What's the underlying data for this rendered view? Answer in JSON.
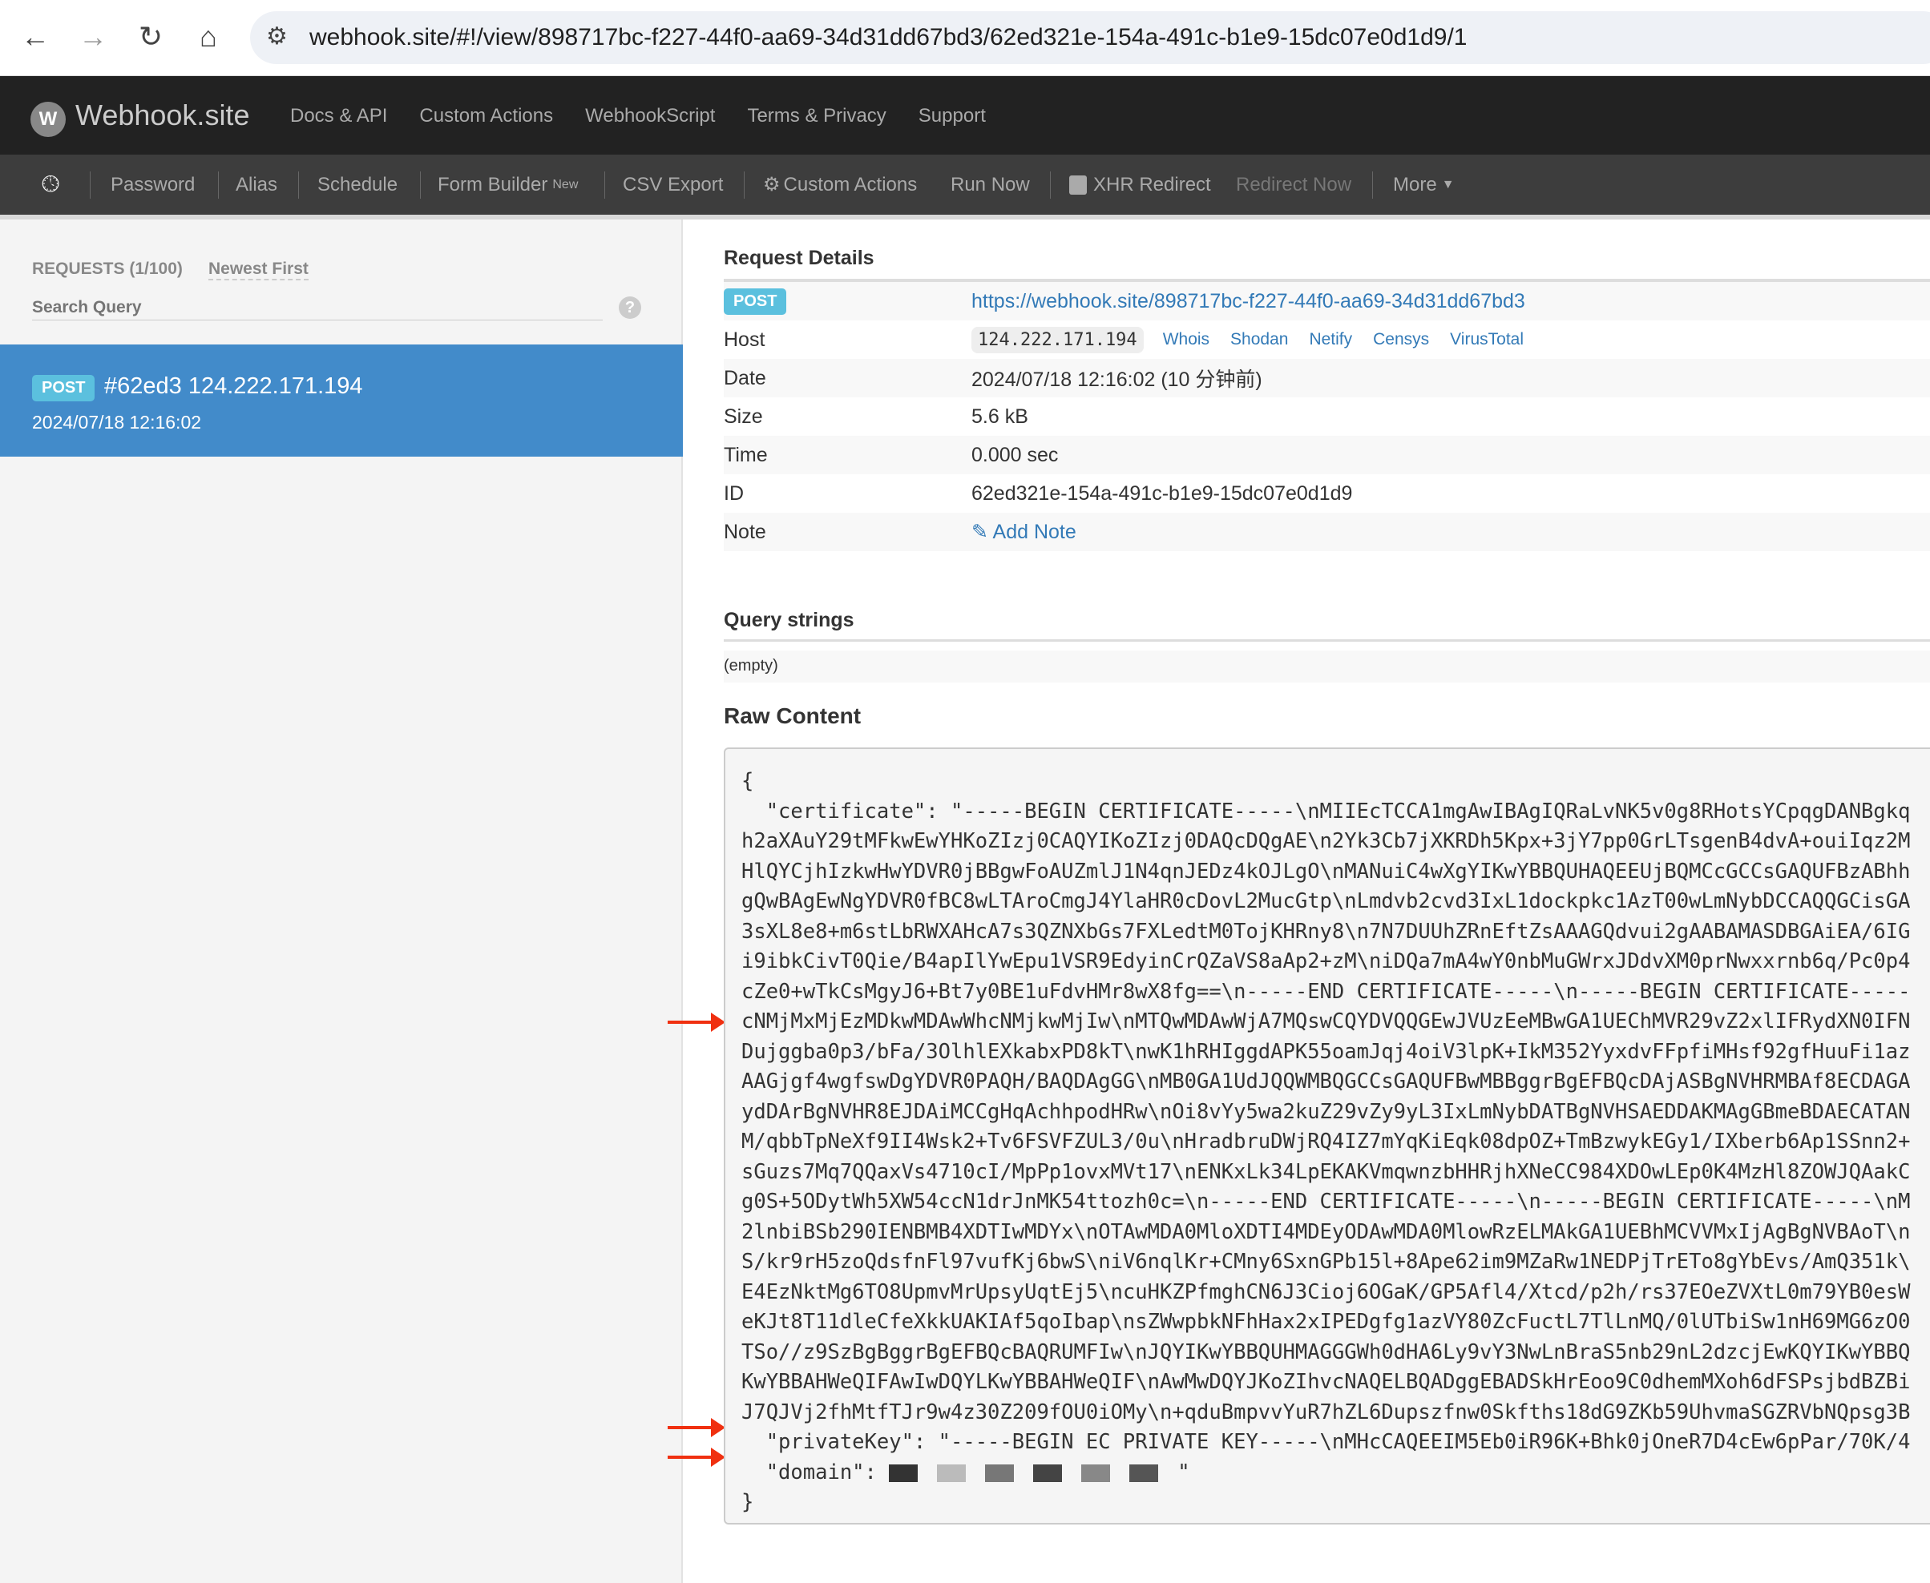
{
  "browser": {
    "url": "webhook.site/#!/view/898717bc-f227-44f0-aa69-34d31dd67bd3/62ed321e-154a-491c-b1e9-15dc07e0d1d9/1"
  },
  "nav": {
    "brand": "Webhook.site",
    "links": [
      "Docs & API",
      "Custom Actions",
      "WebhookScript",
      "Terms & Privacy",
      "Support"
    ]
  },
  "toolbar": {
    "password": "Password",
    "alias": "Alias",
    "schedule": "Schedule",
    "form_builder": "Form Builder",
    "form_builder_badge": "New",
    "csv_export": "CSV Export",
    "custom_actions": "Custom Actions",
    "run_now": "Run Now",
    "xhr_redirect": "XHR Redirect",
    "redirect_now": "Redirect Now",
    "more": "More"
  },
  "sidebar": {
    "requests_label": "REQUESTS (1/100)",
    "sort_label": "Newest First",
    "search_placeholder": "Search Query",
    "help": "?",
    "items": [
      {
        "method": "POST",
        "title": "#62ed3 124.222.171.194",
        "date": "2024/07/18 12:16:02"
      }
    ]
  },
  "details": {
    "heading": "Request Details",
    "method": "POST",
    "url": "https://webhook.site/898717bc-f227-44f0-aa69-34d31dd67bd3",
    "host_label": "Host",
    "host": "124.222.171.194",
    "host_links": [
      "Whois",
      "Shodan",
      "Netify",
      "Censys",
      "VirusTotal"
    ],
    "date_label": "Date",
    "date": "2024/07/18 12:16:02 (10 分钟前)",
    "size_label": "Size",
    "size": "5.6 kB",
    "time_label": "Time",
    "time": "0.000 sec",
    "id_label": "ID",
    "id": "62ed321e-154a-491c-b1e9-15dc07e0d1d9",
    "note_label": "Note",
    "add_note": "Add Note"
  },
  "query": {
    "heading": "Query strings",
    "value": "(empty)"
  },
  "raw": {
    "heading": "Raw Content",
    "lines": [
      "{",
      "  \"certificate\": \"-----BEGIN CERTIFICATE-----\\nMIIEcTCCA1mgAwIBAgIQRaLvNK5v0g8RHotsYCpqgDANBgkq",
      "h2aXAuY29tMFkwEwYHKoZIzj0CAQYIKoZIzj0DAQcDQgAE\\n2Yk3Cb7jXKRDh5Kpx+3jY7pp0GrLTsgenB4dvA+ouiIqz2M",
      "HlQYCjhIzkwHwYDVR0jBBgwFoAUZmlJ1N4qnJEDz4kOJLgO\\nMANuiC4wXgYIKwYBBQUHAQEEUjBQMCcGCCsGAQUFBzABhh",
      "gQwBAgEwNgYDVR0fBC8wLTAroCmgJ4YlaHR0cDovL2MucGtp\\nLmdvb2cvd3IxL1dockpkc1AzT00wLmNybDCCAQQGCisGA",
      "3sXL8e8+m6stLbRWXAHcA7s3QZNXbGs7FXLedtM0TojKHRny8\\n7N7DUUhZRnEftZsAAAGQdvui2gAABAMASDBGAiEA/6IG",
      "i9ibkCivT0Qie/B4apIlYwEpu1VSR9EdyinCrQZaVS8aAp2+zM\\niDQa7mA4wY0nbMuGWrxJDdvXM0prNwxxrnb6q/Pc0p4",
      "cZe0+wTkCsMgyJ6+Bt7y0BE1uFdvHMr8wX8fg==\\n-----END CERTIFICATE-----\\n-----BEGIN CERTIFICATE-----",
      "cNMjMxMjEzMDkwMDAwWhcNMjkwMjIw\\nMTQwMDAwWjA7MQswCQYDVQQGEwJVUzEeMBwGA1UEChMVR29vZ2xlIFRydXN0IFN",
      "Dujggba0p3/bFa/3OlhlEXkabxPD8kT\\nwK1hRHIggdAPK55oamJqj4oiV3lpK+IkM352YyxdvFFpfiMHsf92gfHuuFi1az",
      "AAGjgf4wgfswDgYDVR0PAQH/BAQDAgGG\\nMB0GA1UdJQQWMBQGCCsGAQUFBwMBBggrBgEFBQcDAjASBgNVHRMBAf8ECDAGA",
      "ydDArBgNVHR8EJDAiMCCgHqAchhpodHRw\\nOi8vYy5wa2kuZ29vZy9yL3IxLmNybDATBgNVHSAEDDAKMAgGBmeBDAECATAN",
      "M/qbbTpNeXf9II4Wsk2+Tv6FSVFZUL3/0u\\nHradbruDWjRQ4IZ7mYqKiEqk08dpOZ+TmBzwykEGy1/IXberb6Ap1SSnn2+",
      "sGuzs7Mq7QQaxVs4710cI/MpPp1ovxMVt17\\nENKxLk34LpEKAKVmqwnzbHHRjhXNeCC984XDOwLEp0K4MzHl8ZOWJQAakC",
      "g0S+5ODytWh5XW54ccN1drJnMK54ttozh0c=\\n-----END CERTIFICATE-----\\n-----BEGIN CERTIFICATE-----\\nM",
      "2lnbiBSb290IENBMB4XDTIwMDYx\\nOTAwMDA0MloXDTI4MDEyODAwMDA0MlowRzELMAkGA1UEBhMCVVMxIjAgBgNVBAoT\\n",
      "S/kr9rH5zoQdsfnFl97vufKj6bwS\\niV6nqlKr+CMny6SxnGPb15l+8Ape62im9MZaRw1NEDPjTrETo8gYbEvs/AmQ351k\\",
      "E4EzNktMg6TO8UpmvMrUpsyUqtEj5\\ncuHKZPfmghCN6J3Cioj6OGaK/GP5Afl4/Xtcd/p2h/rs37EOeZVXtL0m79YB0esW",
      "eKJt8T11dleCfeXkkUAKIAf5qoIbap\\nsZWwpbkNFhHax2xIPEDgfg1azVY80ZcFuctL7TlLnMQ/0lUTbiSw1nH69MG6zO0",
      "TSo//z9SzBgBggrBgEFBQcBAQRUMFIw\\nJQYIKwYBBQUHMAGGGWh0dHA6Ly9vY3NwLnBraS5nb29nL2dzcjEwKQYIKwYBBQ",
      "KwYBBAHWeQIFAwIwDQYLKwYBBAHWeQIF\\nAwMwDQYJKoZIhvcNAQELBQADggEBADSkHrEoo9C0dhemMXoh6dFSPsjbdBZBi",
      "J7QJVj2fhMtfTJr9w4z30Z209fOU0iOMy\\n+qduBmpvvYuR7hZL6Dupszfnw0Skfths18dG9ZKb59UhvmaSGZRVbNQpsg3B",
      "  \"privateKey\": \"-----BEGIN EC PRIVATE KEY-----\\nMHcCAQEEIM5Eb0iR96K+Bhk0jOneR7D4cEw6pPar/70K/4"
    ],
    "domain_key": "  \"domain\": ",
    "domain_close": "\"",
    "closing": "}"
  },
  "colors": {
    "accent": "#428bca",
    "badge": "#5bc0de",
    "link": "#337ab7",
    "arrow": "#f03010"
  }
}
